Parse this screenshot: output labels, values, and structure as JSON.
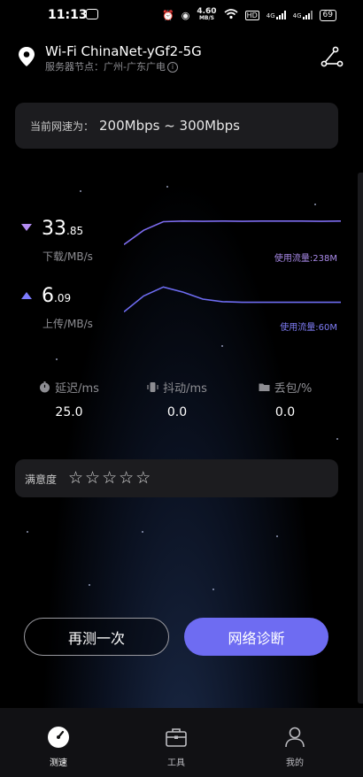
{
  "status_bar": {
    "time": "11:13",
    "net_speed": "4.60",
    "net_speed_unit": "MB/S",
    "hd": "HD",
    "signal1": "4G",
    "signal2": "4G",
    "battery": "69"
  },
  "header": {
    "wifi_name": "Wi-Fi ChinaNet-yGf2-5G",
    "node_label": "服务器节点：",
    "node_value": "广州-广东广电",
    "info_glyph": "i"
  },
  "range": {
    "label": "当前网速为：",
    "value": "200Mbps ~ 300Mbps"
  },
  "download": {
    "int": "33",
    "dec": ".85",
    "unit": "下载/MB/s",
    "usage": "使用流量:238M",
    "color": "#7d6cf0",
    "curve": [
      0.1,
      0.55,
      0.82,
      0.84,
      0.83,
      0.84,
      0.83,
      0.84,
      0.84,
      0.84,
      0.83,
      0.84
    ]
  },
  "upload": {
    "int": "6",
    "dec": ".09",
    "unit": "上传/MB/s",
    "usage": "使用流量:60M",
    "color": "#6e6cf2",
    "curve": [
      0.1,
      0.6,
      0.88,
      0.72,
      0.5,
      0.42,
      0.4,
      0.4,
      0.4,
      0.4,
      0.4,
      0.4
    ]
  },
  "stats": {
    "latency_label": "延迟/ms",
    "latency_value": "25.0",
    "jitter_label": "抖动/ms",
    "jitter_value": "0.0",
    "loss_label": "丢包/%",
    "loss_value": "0.0"
  },
  "satisfaction": {
    "label": "满意度",
    "stars_total": 5,
    "stars_filled": 0,
    "star_glyph": "☆"
  },
  "buttons": {
    "retest": "再测一次",
    "diagnose": "网络诊断"
  },
  "tabs": {
    "speedtest": "测速",
    "tools": "工具",
    "mine": "我的"
  },
  "colors": {
    "accent": "#6e6cf2",
    "download_arrow": "#b48cf2",
    "upload_arrow": "#7d7cff"
  }
}
